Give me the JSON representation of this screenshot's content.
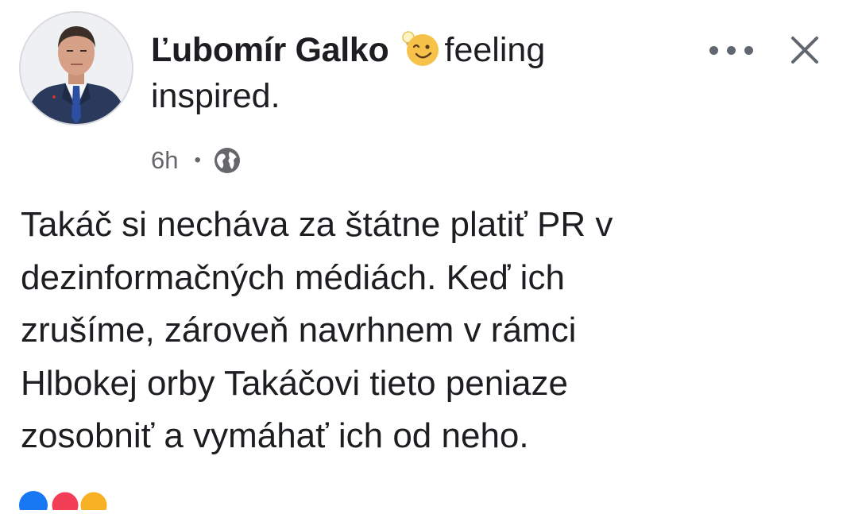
{
  "post": {
    "author": "Ľubomír Galko",
    "feeling_emoji": "inspired-face-emoji",
    "feeling_text_1": "feeling",
    "feeling_text_2": "inspired.",
    "timestamp": "6h",
    "separator": "•",
    "audience_icon": "globe-icon",
    "body": "Takáč si necháva za štátne platiť PR v\ndezinformačných médiách. Keď ich\nzrušíme, zároveň navrhnem v rámci\nHlbokej orby Takáčovi tieto peniaze\nzosobniť a vymáhať ich od neho."
  },
  "actions": {
    "more_icon": "more-horizontal-icon",
    "close_icon": "close-icon"
  },
  "colors": {
    "text_primary": "#1c1e21",
    "text_secondary": "#65676b",
    "icon_gray": "#606770",
    "emoji_yellow": "#f7c24a",
    "like_blue": "#1877f2",
    "love_red": "#f33e58",
    "haha_yellow": "#f7b125"
  }
}
